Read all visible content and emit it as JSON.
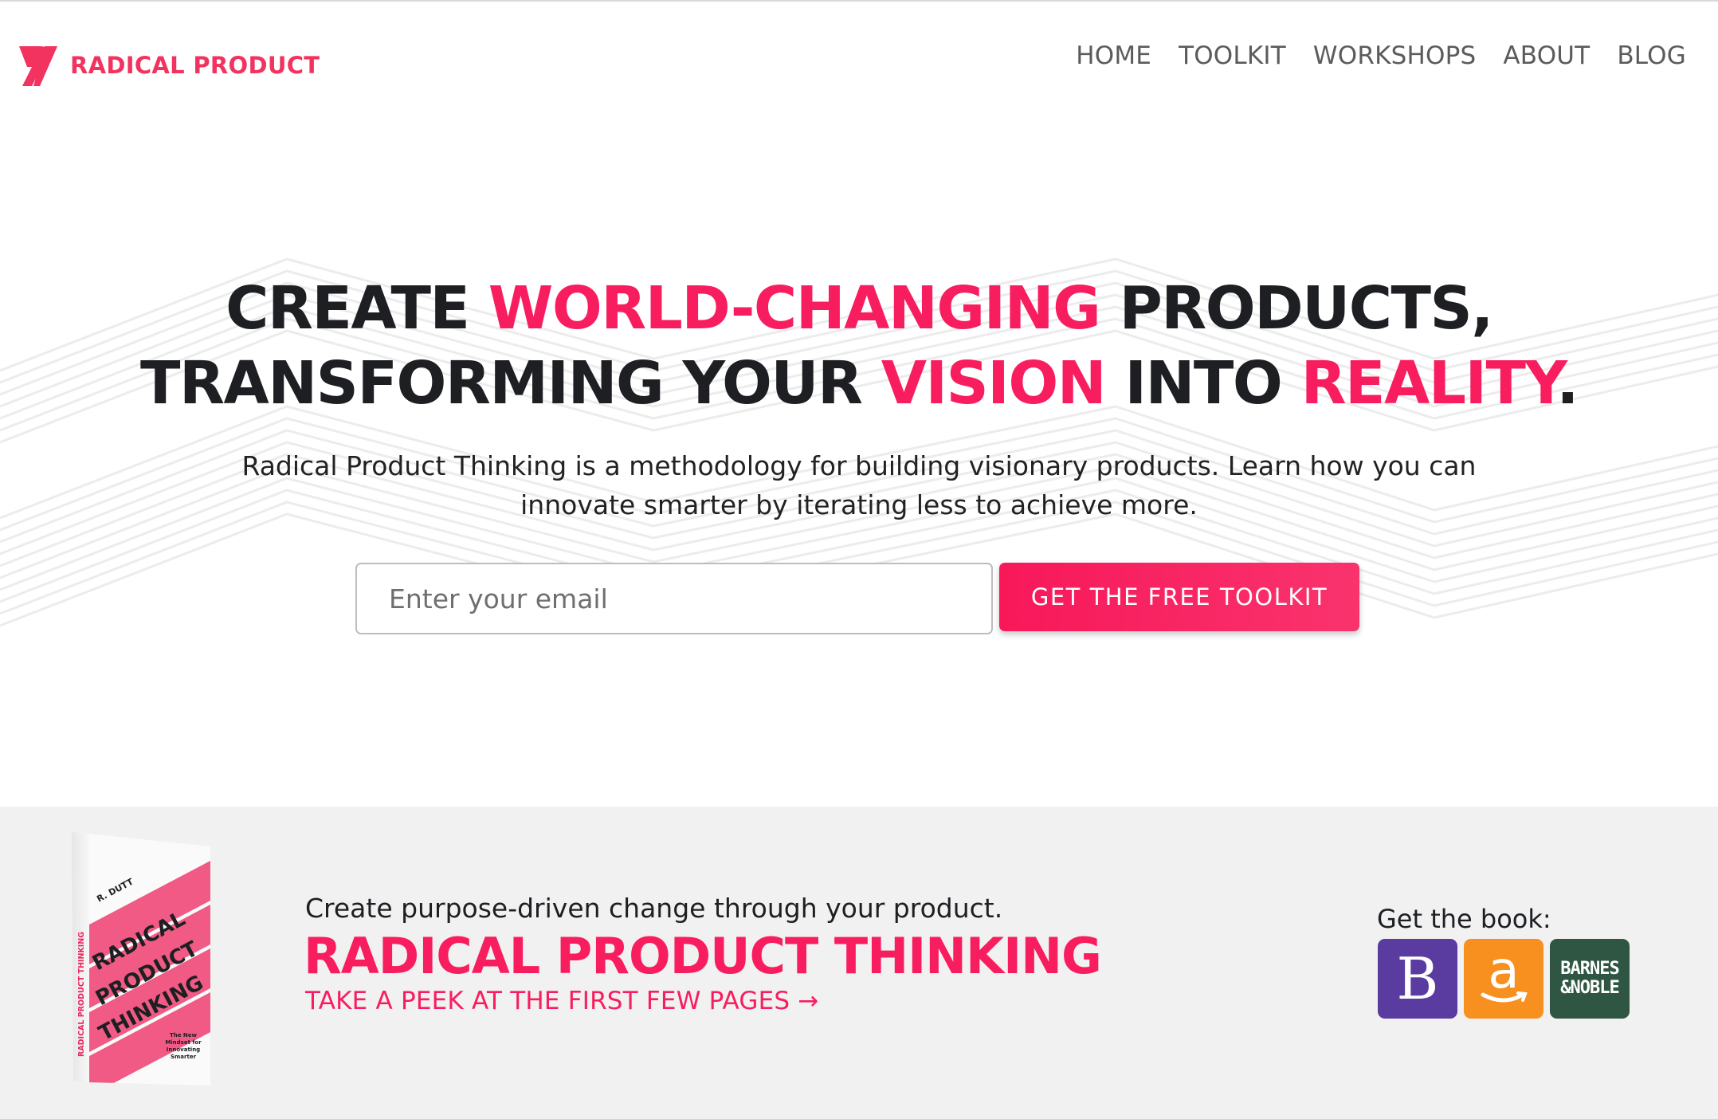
{
  "brand": {
    "name": "RADICAL PRODUCT",
    "accent_color": "#f81d5f"
  },
  "nav": {
    "items": [
      "HOME",
      "TOOLKIT",
      "WORKSHOPS",
      "ABOUT",
      "BLOG"
    ]
  },
  "hero": {
    "line1": {
      "a": "CREATE ",
      "b": "WORLD-CHANGING",
      "c": " PRODUCTS,"
    },
    "line2": {
      "a": "TRANSFORMING YOUR ",
      "b": "VISION",
      "c": " INTO ",
      "d": "REALITY",
      "e": "."
    },
    "subtitle": "Radical Product Thinking is a methodology for building visionary products. Learn how you can innovate smarter by iterating less to achieve more.",
    "email_placeholder": "Enter your email",
    "cta_label": "GET THE FREE TOOLKIT"
  },
  "book": {
    "tagline": "Create purpose-driven change through your product.",
    "title": "RADICAL PRODUCT THINKING",
    "peek_label": "TAKE A PEEK AT THE FIRST FEW PAGES",
    "peek_arrow": "→",
    "cover": {
      "author": "R. DUTT",
      "spine": "RADICAL PRODUCT THINKING",
      "words": [
        "RADICAL",
        "PRODUCT",
        "THINKING"
      ],
      "subtitle": "The New Mindset for Innovating Smarter"
    },
    "get_book_label": "Get the book:",
    "stores": {
      "bookshop_letter": "B",
      "amazon_letter": "a",
      "bn_line1": "BARNES",
      "bn_line2": "&NOBLE"
    }
  }
}
